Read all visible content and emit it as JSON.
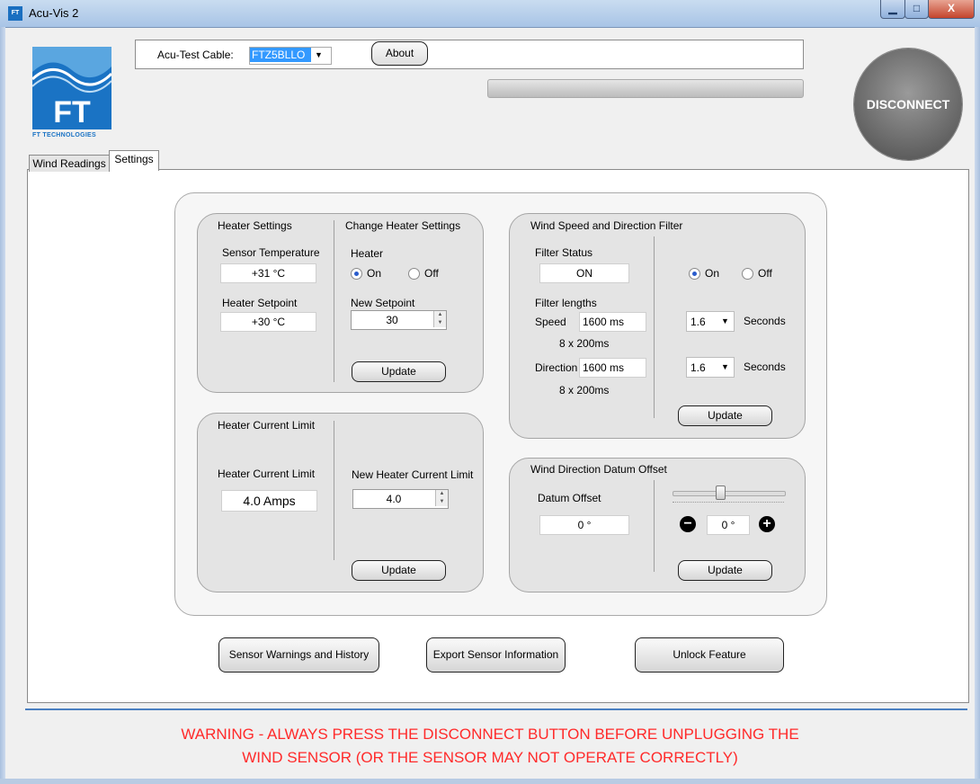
{
  "window": {
    "title": "Acu-Vis 2",
    "app_icon": "FT",
    "min": "▁",
    "max": "□",
    "close": "X"
  },
  "logo": {
    "letters": "FT",
    "caption": "FT TECHNOLOGIES"
  },
  "header": {
    "cable_label": "Acu-Test Cable:",
    "cable_value": "FTZ5BLLO",
    "about_label": "About",
    "disconnect_label": "DISCONNECT"
  },
  "tabs": [
    {
      "label": "Wind Readings"
    },
    {
      "label": "Settings"
    }
  ],
  "heater": {
    "title": "Heater Settings",
    "sensor_temp_label": "Sensor Temperature",
    "sensor_temp_value": "+31 °C",
    "setpoint_label": "Heater Setpoint",
    "setpoint_value": "+30 °C",
    "change_title": "Change Heater Settings",
    "heater_label": "Heater",
    "on_label": "On",
    "off_label": "Off",
    "heater_state": "On",
    "new_setpoint_label": "New Setpoint",
    "new_setpoint_value": "30",
    "update_label": "Update"
  },
  "current_limit": {
    "title": "Heater Current Limit",
    "limit_label": "Heater Current Limit",
    "limit_value": "4.0 Amps",
    "new_limit_label": "New Heater Current Limit",
    "new_limit_value": "4.0",
    "update_label": "Update"
  },
  "filter": {
    "title": "Wind Speed and Direction Filter",
    "status_label": "Filter Status",
    "status_value": "ON",
    "lengths_label": "Filter lengths",
    "speed_label": "Speed",
    "speed_value": "1600 ms",
    "speed_note": "8 x 200ms",
    "direction_label": "Direction",
    "direction_value": "1600 ms",
    "direction_note": "8 x 200ms",
    "on_label": "On",
    "off_label": "Off",
    "state": "On",
    "speed_select": "1.6",
    "direction_select": "1.6",
    "seconds_label": "Seconds",
    "update_label": "Update"
  },
  "datum": {
    "title": "Wind Direction Datum Offset",
    "offset_label": "Datum Offset",
    "offset_value": "0 °",
    "stepper_value": "0 °",
    "slider_level": 0.42,
    "update_label": "Update"
  },
  "bottom_buttons": {
    "warnings": "Sensor Warnings and History",
    "export": "Export Sensor Information",
    "unlock": "Unlock Feature"
  },
  "warning": {
    "line1": "WARNING - ALWAYS PRESS THE DISCONNECT BUTTON BEFORE UNPLUGGING THE",
    "line2": "WIND SENSOR (OR THE SENSOR MAY NOT OPERATE CORRECTLY)"
  },
  "colors": {
    "accent": "#1a73c4",
    "warning": "#ff2a2a",
    "selection": "#3399ff"
  }
}
